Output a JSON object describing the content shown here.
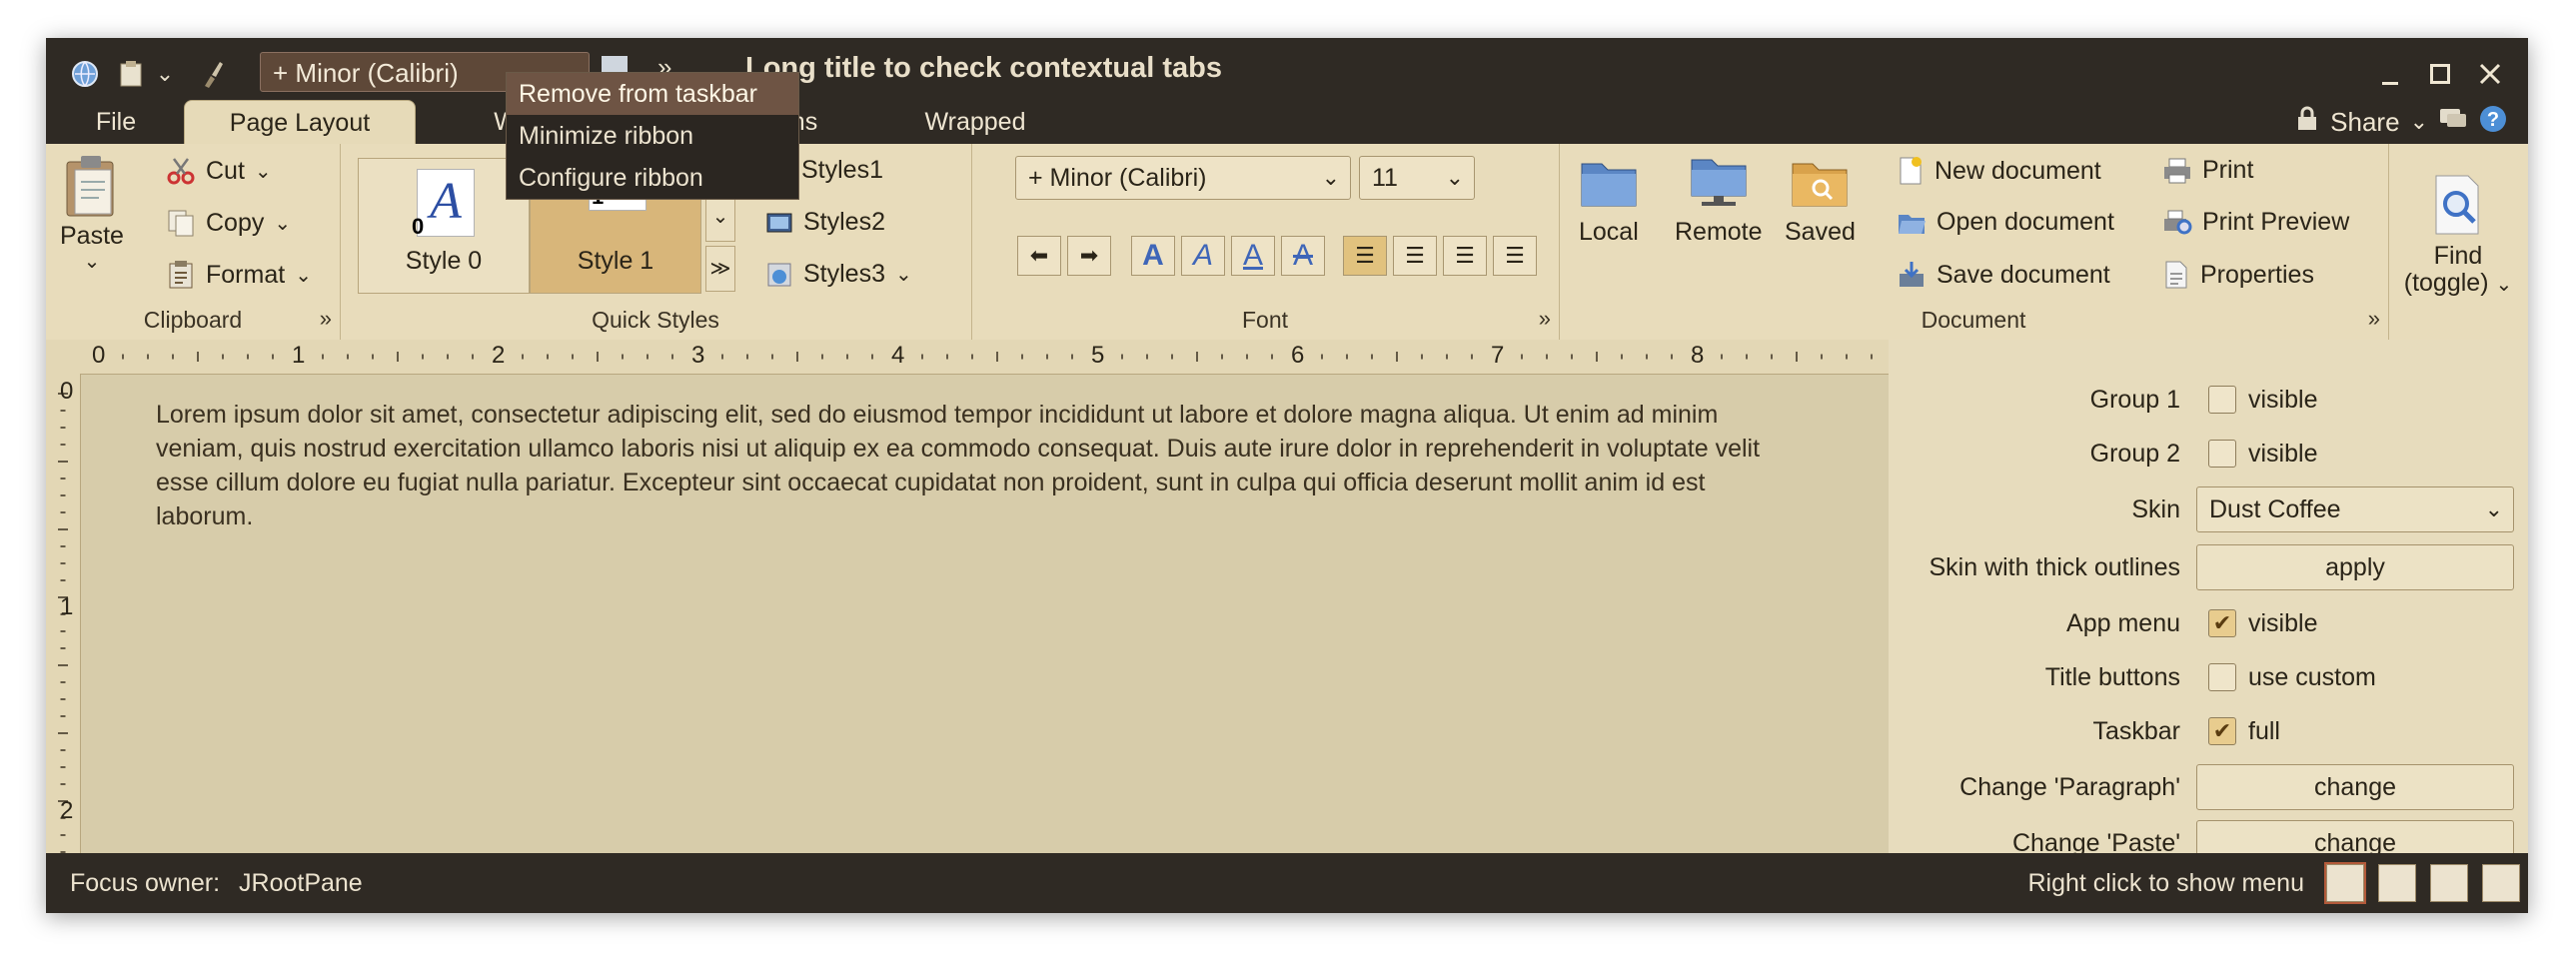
{
  "window": {
    "title": "Long title to check contextual tabs",
    "font_combo": "+ Minor (Calibri)"
  },
  "tabs": [
    {
      "label": "File"
    },
    {
      "label": "Page Layout"
    },
    {
      "label": "W"
    },
    {
      "label": "ns"
    },
    {
      "label": "Wrapped"
    }
  ],
  "share": {
    "label": "Share"
  },
  "popup": {
    "items": [
      "Remove from taskbar",
      "Minimize ribbon",
      "Configure ribbon"
    ]
  },
  "clipboard": {
    "paste": "Paste",
    "cut": "Cut",
    "copy": "Copy",
    "format": "Format",
    "group_label": "Clipboard"
  },
  "quick_styles": {
    "style0": "Style 0",
    "style1": "Style 1",
    "style0_glyph": "A",
    "style0_num": "0",
    "style1_num": "1",
    "styles1": "Styles1",
    "styles2": "Styles2",
    "styles3": "Styles3",
    "group_label": "Quick Styles"
  },
  "font": {
    "family": "+ Minor (Calibri)",
    "size": "11",
    "group_label": "Font"
  },
  "document": {
    "local": "Local",
    "remote": "Remote",
    "saved": "Saved",
    "new_document": "New document",
    "open_document": "Open document",
    "save_document": "Save document",
    "print": "Print",
    "print_preview": "Print Preview",
    "properties": "Properties",
    "group_label": "Document"
  },
  "find": {
    "line1": "Find",
    "line2": "(toggle)"
  },
  "ruler": {
    "h_numbers": [
      "0",
      "1",
      "2",
      "3",
      "4",
      "5",
      "6",
      "7",
      "8"
    ],
    "v_numbers": [
      "0",
      "1",
      "2"
    ]
  },
  "editor": {
    "text": "Lorem ipsum dolor sit amet, consectetur adipiscing elit, sed do eiusmod tempor incididunt ut labore et dolore magna aliqua. Ut enim ad minim veniam, quis nostrud exercitation ullamco laboris nisi ut aliquip ex ea commodo consequat. Duis aute irure dolor in reprehenderit in voluptate velit esse cillum dolore eu fugiat nulla pariatur. Excepteur sint occaecat cupidatat non proident, sunt in culpa qui officia deserunt mollit anim id est laborum."
  },
  "side_panel": {
    "group1": {
      "label": "Group 1",
      "check": "visible",
      "checked": false
    },
    "group2": {
      "label": "Group 2",
      "check": "visible",
      "checked": false
    },
    "skin": {
      "label": "Skin",
      "value": "Dust Coffee"
    },
    "thick": {
      "label": "Skin with thick outlines",
      "button": "apply"
    },
    "app_menu": {
      "label": "App menu",
      "check": "visible",
      "checked": true
    },
    "title_buttons": {
      "label": "Title buttons",
      "check": "use custom",
      "checked": false
    },
    "taskbar": {
      "label": "Taskbar",
      "check": "full",
      "checked": true
    },
    "change_paragraph": {
      "label": "Change 'Paragraph'",
      "button": "change"
    },
    "change_paste": {
      "label": "Change 'Paste'",
      "button": "change"
    }
  },
  "status": {
    "focus_label": "Focus owner:",
    "focus_value": "JRootPane",
    "hint": "Right click to show menu"
  },
  "colors": {
    "titlebar": "#2f2a24",
    "ribbon": "#e8dcbb",
    "accent_selected": "#e1c27e",
    "menu_highlight": "#6e5444"
  }
}
